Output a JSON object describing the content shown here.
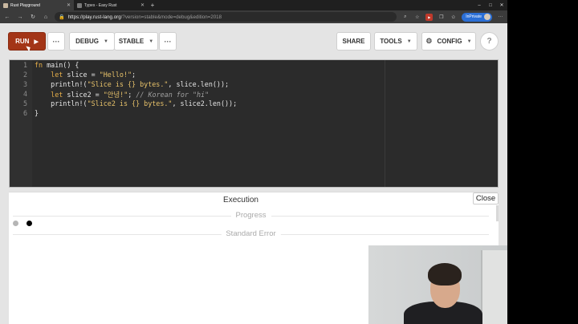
{
  "browser": {
    "tabs": [
      {
        "label": "Rust Playground",
        "active": true
      },
      {
        "label": "Types - Easy Rust",
        "active": false
      }
    ],
    "new_tab": "+",
    "window_controls": {
      "minimize": "–",
      "maximize": "□",
      "close": "✕"
    },
    "url": {
      "scheme": "https://",
      "host": "play.rust-lang.org",
      "path": "/?version=stable&mode=debug&edition=2018"
    },
    "profile_label": "InPrivate"
  },
  "toolbar": {
    "run_label": "RUN",
    "more_label": "···",
    "debug_label": "DEBUG",
    "stable_label": "STABLE",
    "share_label": "SHARE",
    "tools_label": "TOOLS",
    "config_label": "CONFIG",
    "help_label": "?"
  },
  "editor": {
    "line_numbers": [
      "1",
      "2",
      "3",
      "4",
      "5",
      "6"
    ]
  },
  "output": {
    "title": "Execution",
    "close_label": "Close",
    "progress_label": "Progress",
    "stderr_label": "Standard Error"
  }
}
